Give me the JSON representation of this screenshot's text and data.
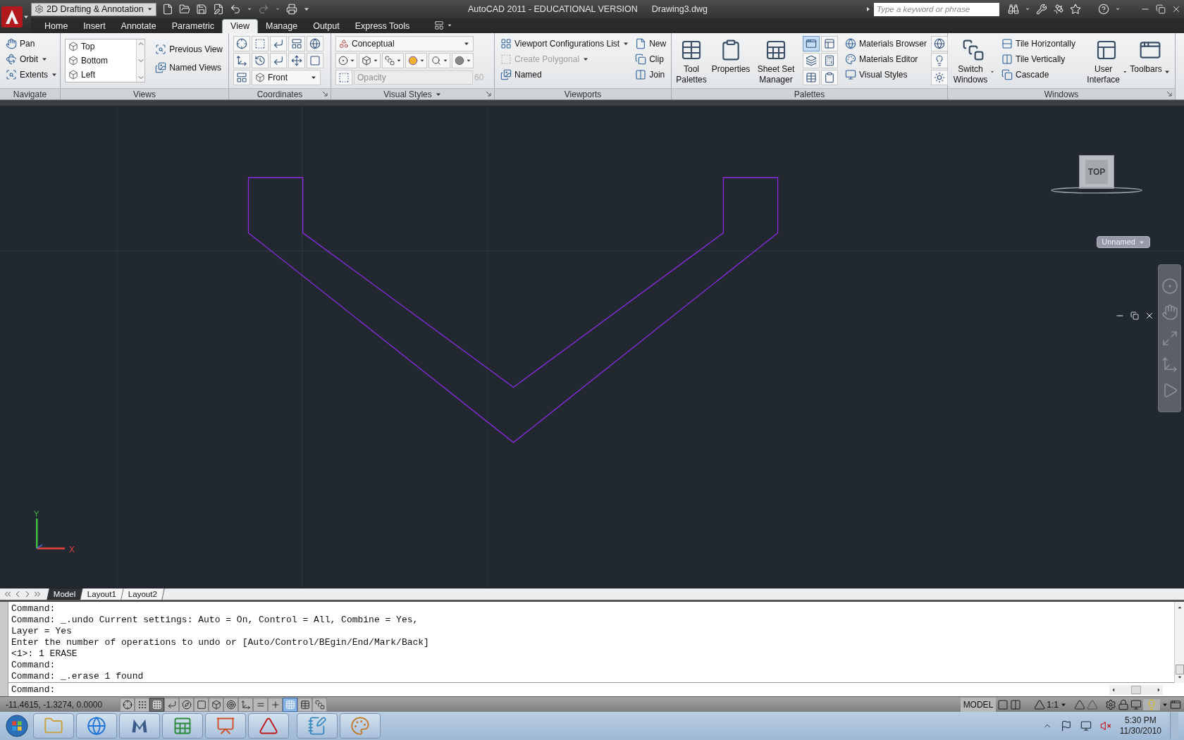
{
  "quick_access": {
    "workspace": "2D Drafting & Annotation"
  },
  "title_bar": {
    "app": "AutoCAD 2011 - EDUCATIONAL VERSION",
    "document": "Drawing3.dwg",
    "search_placeholder": "Type a keyword or phrase"
  },
  "tabs": [
    {
      "label": "Home",
      "selected": false
    },
    {
      "label": "Insert",
      "selected": false
    },
    {
      "label": "Annotate",
      "selected": false
    },
    {
      "label": "Parametric",
      "selected": false
    },
    {
      "label": "View",
      "selected": true
    },
    {
      "label": "Manage",
      "selected": false
    },
    {
      "label": "Output",
      "selected": false
    },
    {
      "label": "Express Tools",
      "selected": false
    }
  ],
  "ribbon": {
    "navigate": {
      "title": "Navigate",
      "tools": [
        {
          "label": "Pan",
          "dropdown": false
        },
        {
          "label": "Orbit",
          "dropdown": true
        },
        {
          "label": "Extents",
          "dropdown": true
        }
      ]
    },
    "views": {
      "title": "Views",
      "list": [
        "Top",
        "Bottom",
        "Left"
      ],
      "tools": [
        "Previous View",
        "Named Views"
      ]
    },
    "coordinates": {
      "title": "Coordinates",
      "view_dropdown": "Front"
    },
    "visual_styles": {
      "title": "Visual Styles",
      "style_dropdown": "Conceptual",
      "opacity": {
        "placeholder": "Opacity",
        "value": "60",
        "disabled": true
      }
    },
    "viewports": {
      "title": "Viewports",
      "tools": [
        {
          "label": "Viewport Configurations List",
          "dropdown": true,
          "disabled": false
        },
        {
          "label": "Create Polygonal",
          "dropdown": true,
          "disabled": true
        },
        {
          "label": "Named",
          "dropdown": false,
          "disabled": false
        }
      ],
      "edit_tools": [
        "New",
        "Clip",
        "Join"
      ]
    },
    "palettes": {
      "title": "Palettes",
      "large_tools": [
        "Tool Palettes",
        "Properties",
        "Sheet Set Manager"
      ],
      "toggles": [
        {
          "on": true
        },
        {
          "on": false
        },
        {
          "on": false
        },
        {
          "on": false
        },
        {
          "on": false
        },
        {
          "on": false
        }
      ],
      "material_tools": [
        "Materials Browser",
        "Materials Editor",
        "Visual Styles"
      ]
    },
    "windows": {
      "title": "Windows",
      "switch": {
        "label": "Switch Windows",
        "dropdown": true
      },
      "tile_tools": [
        "Tile Horizontally",
        "Tile Vertically",
        "Cascade"
      ],
      "ui_tools": [
        {
          "label": "User Interface",
          "dropdown": true
        },
        {
          "label": "Toolbars",
          "dropdown": true
        }
      ]
    }
  },
  "viewport": {
    "view_cube_face": "TOP",
    "ucs_menu": "Unnamed",
    "axis_x": "X",
    "axis_y": "Y"
  },
  "layout_tabs": [
    {
      "label": "Model",
      "selected": true
    },
    {
      "label": "Layout1",
      "selected": false
    },
    {
      "label": "Layout2",
      "selected": false
    }
  ],
  "command_history": [
    "Command:",
    "Command: _.undo Current settings: Auto = On, Control = All, Combine = Yes,",
    "Layer = Yes",
    "Enter the number of operations to undo or [Auto/Control/BEgin/End/Mark/Back]",
    "<1>: 1 ERASE",
    "Command:",
    "Command: _.erase 1 found"
  ],
  "command_prompt": "Command:",
  "status_bar": {
    "coordinates": "-11.4615, -1.3274, 0.0000",
    "toggles": [
      {
        "kind": "infer",
        "on": false
      },
      {
        "kind": "snap",
        "on": false
      },
      {
        "kind": "grid",
        "on": true
      },
      {
        "kind": "ortho",
        "on": false
      },
      {
        "kind": "polar",
        "on": false
      },
      {
        "kind": "osnap",
        "on": false
      },
      {
        "kind": "osnap3d",
        "on": false
      },
      {
        "kind": "otrack",
        "on": false
      },
      {
        "kind": "ducs",
        "on": false
      },
      {
        "kind": "dyn",
        "on": false
      },
      {
        "kind": "lwt",
        "on": false
      },
      {
        "kind": "tpy",
        "on": true
      },
      {
        "kind": "qp",
        "on": false
      },
      {
        "kind": "sc",
        "on": false
      }
    ],
    "space": "MODEL",
    "annotation_scale": "1:1"
  },
  "taskbar": {
    "time": "5:30 PM",
    "date": "11/30/2010"
  }
}
